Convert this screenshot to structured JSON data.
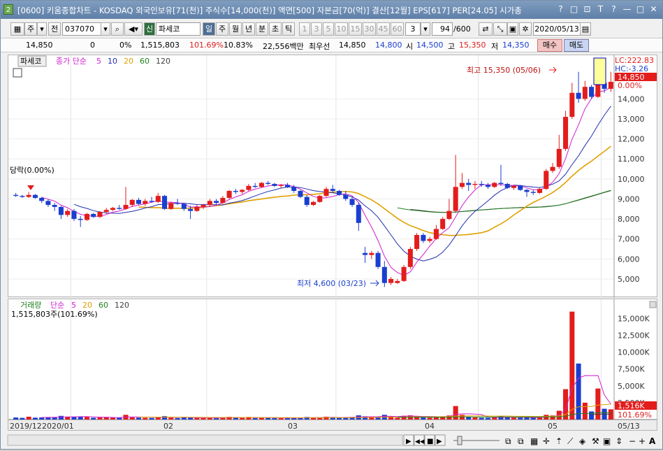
{
  "window": {
    "number": "2",
    "title": "[0600] 키움종합차트 - KOSDAQ 외국인보유[71(천)] 주식수[14,000(천)] 액면[500] 자본금[70(억)] 결산[12월] EPS[617] PER[24.05] 시가총",
    "buttons": [
      "?",
      "□",
      "⊡",
      "T",
      "?",
      "—",
      "□",
      "✕"
    ]
  },
  "toolbar": {
    "period_label": "주",
    "prev_label": "전",
    "code": "037070",
    "credit_label": "신",
    "stock_name": "파세코",
    "intervals": [
      "일",
      "주",
      "월",
      "년",
      "분",
      "초",
      "틱"
    ],
    "selected_interval": "일",
    "minute_options": [
      "1",
      "3",
      "5",
      "10",
      "15",
      "30",
      "45",
      "60"
    ],
    "count_select": "3",
    "page_count": "94",
    "page_total": "/600",
    "date": "2020/05/13"
  },
  "info": {
    "price": "14,850",
    "change": "0",
    "change_pct": "0%",
    "volume": "1,515,803",
    "volume_pct": "101.69%",
    "turnover": "10.83%",
    "amount": "22,556백만",
    "best_ask_label": "최우선",
    "best_ask": "14,850",
    "best_bid": "14,800",
    "open_label": "시",
    "open": "14,500",
    "high_label": "고",
    "high": "15,350",
    "low_label": "저",
    "low": "14,350",
    "buy_label": "매수",
    "sell_label": "매도"
  },
  "price_panel": {
    "stock_label": "파세코",
    "ma_label": "종가 단순",
    "ma_periods": [
      "5",
      "10",
      "20",
      "60",
      "120"
    ],
    "ma_colors": [
      "#d020d0",
      "#2030b0",
      "#e0a000",
      "#208020",
      "#404040"
    ],
    "lc_label": "LC:222.83",
    "hc_label": "HC:-3.26",
    "current_price_tag": "14,850",
    "current_pct_tag": "0.00%",
    "high_marker": "최고 15,350 (05/06)",
    "low_marker": "최저 4,600 (03/23)",
    "left_marker": "당락(0.00%)",
    "y_ticks": [
      "14,000",
      "13,000",
      "12,000",
      "11,000",
      "10,000",
      "9,000",
      "8,000",
      "7,000",
      "6,000",
      "5,000"
    ]
  },
  "volume_panel": {
    "label": "거래량",
    "ma_label": "단순",
    "ma_periods": [
      "5",
      "20",
      "60",
      "120"
    ],
    "value_text": "1,515,803주(101.69%)",
    "current_tag": "1,516K",
    "current_pct_tag": "101.69%",
    "y_ticks": [
      "15,000K",
      "12,500K",
      "10,000K",
      "7,500K",
      "5,000K",
      "2,500K"
    ]
  },
  "xaxis": {
    "labels": [
      "2019/12",
      "2020/01",
      "02",
      "03",
      "04",
      "05",
      "05/13"
    ]
  },
  "chart_data": {
    "type": "candlestick",
    "price_ylim": [
      4300,
      15900
    ],
    "volume_ylim": [
      0,
      17000
    ],
    "up_color": "#e31c1c",
    "down_color": "#1a3fcf",
    "candles": [
      [
        9200,
        9300,
        9100,
        9150,
        300
      ],
      [
        9150,
        9200,
        9050,
        9100,
        250
      ],
      [
        9100,
        9350,
        9050,
        9200,
        420
      ],
      [
        9200,
        9250,
        9000,
        9050,
        280
      ],
      [
        9050,
        9100,
        8800,
        8900,
        320
      ],
      [
        8900,
        9000,
        8600,
        8700,
        360
      ],
      [
        8700,
        8800,
        8400,
        8600,
        300
      ],
      [
        8600,
        8650,
        8000,
        8200,
        540
      ],
      [
        8200,
        8500,
        8100,
        8400,
        420
      ],
      [
        8400,
        8500,
        7900,
        8000,
        380
      ],
      [
        8000,
        8150,
        7600,
        7950,
        460
      ],
      [
        7950,
        8300,
        7900,
        8250,
        380
      ],
      [
        8250,
        8300,
        8050,
        8100,
        260
      ],
      [
        8100,
        8400,
        8050,
        8350,
        300
      ],
      [
        8350,
        8550,
        8250,
        8450,
        340
      ],
      [
        8450,
        8600,
        8400,
        8550,
        280
      ],
      [
        8550,
        8700,
        8450,
        8500,
        260
      ],
      [
        8500,
        9600,
        8450,
        8700,
        700
      ],
      [
        8700,
        9000,
        8600,
        8950,
        320
      ],
      [
        8950,
        9050,
        8700,
        8750,
        280
      ],
      [
        8750,
        9000,
        8650,
        8900,
        260
      ],
      [
        8900,
        9100,
        8800,
        8850,
        240
      ],
      [
        8850,
        9300,
        8800,
        9150,
        380
      ],
      [
        9150,
        9200,
        8450,
        8500,
        500
      ],
      [
        8500,
        8850,
        8450,
        8800,
        280
      ],
      [
        8800,
        9000,
        8700,
        8750,
        220
      ],
      [
        8750,
        8800,
        8400,
        8500,
        300
      ],
      [
        8500,
        8650,
        8000,
        8400,
        260
      ],
      [
        8400,
        8700,
        8350,
        8600,
        240
      ],
      [
        8600,
        8750,
        8500,
        8700,
        220
      ],
      [
        8700,
        9000,
        8600,
        8900,
        300
      ],
      [
        8900,
        9000,
        8700,
        8800,
        200
      ],
      [
        8800,
        9150,
        8750,
        9050,
        320
      ],
      [
        9050,
        9450,
        9000,
        9400,
        400
      ],
      [
        9400,
        9500,
        9250,
        9350,
        260
      ],
      [
        9350,
        9500,
        9250,
        9450,
        240
      ],
      [
        9450,
        9750,
        9400,
        9650,
        380
      ],
      [
        9650,
        9800,
        9550,
        9600,
        240
      ],
      [
        9600,
        9850,
        9550,
        9800,
        300
      ],
      [
        9800,
        9900,
        9700,
        9750,
        260
      ],
      [
        9750,
        9800,
        9600,
        9650,
        220
      ],
      [
        9650,
        9750,
        9550,
        9700,
        200
      ],
      [
        9700,
        9800,
        9550,
        9600,
        200
      ],
      [
        9600,
        9700,
        9300,
        9400,
        260
      ],
      [
        9400,
        9450,
        9050,
        9100,
        300
      ],
      [
        9100,
        9200,
        8600,
        8700,
        380
      ],
      [
        8700,
        8900,
        8650,
        8850,
        240
      ],
      [
        8850,
        9200,
        8800,
        9150,
        280
      ],
      [
        9150,
        9600,
        9100,
        9500,
        420
      ],
      [
        9500,
        9700,
        9300,
        9400,
        300
      ],
      [
        9400,
        9450,
        9150,
        9200,
        260
      ],
      [
        9200,
        9400,
        8900,
        9000,
        300
      ],
      [
        9000,
        9100,
        8600,
        8700,
        360
      ],
      [
        8700,
        8800,
        7400,
        7800,
        620
      ],
      [
        6300,
        6600,
        5800,
        6200,
        480
      ],
      [
        6200,
        6400,
        6000,
        6300,
        300
      ],
      [
        6300,
        6400,
        5500,
        5600,
        380
      ],
      [
        5600,
        5900,
        4600,
        4800,
        700
      ],
      [
        4800,
        5100,
        4700,
        5000,
        520
      ],
      [
        4800,
        5000,
        4750,
        4900,
        260
      ],
      [
        4900,
        5700,
        4850,
        5600,
        560
      ],
      [
        5600,
        6600,
        5500,
        6500,
        620
      ],
      [
        6500,
        7300,
        6400,
        7200,
        520
      ],
      [
        7200,
        7300,
        6800,
        6900,
        300
      ],
      [
        6900,
        7100,
        6800,
        7000,
        260
      ],
      [
        7000,
        7700,
        6950,
        7500,
        420
      ],
      [
        7500,
        8100,
        7450,
        8000,
        480
      ],
      [
        8000,
        9000,
        7950,
        8400,
        600
      ],
      [
        8400,
        11200,
        8300,
        9600,
        2000
      ],
      [
        9600,
        10300,
        9500,
        9800,
        700
      ],
      [
        9800,
        10000,
        9400,
        9700,
        420
      ],
      [
        9700,
        9900,
        9500,
        9750,
        300
      ],
      [
        9750,
        9900,
        9600,
        9700,
        260
      ],
      [
        9700,
        9800,
        9500,
        9600,
        260
      ],
      [
        9600,
        9850,
        9550,
        9800,
        300
      ],
      [
        9800,
        10700,
        9650,
        9750,
        500
      ],
      [
        9750,
        9800,
        9500,
        9550,
        300
      ],
      [
        9550,
        9700,
        9450,
        9650,
        260
      ],
      [
        9650,
        9700,
        9400,
        9450,
        280
      ],
      [
        9450,
        9500,
        9100,
        9350,
        300
      ],
      [
        9350,
        9450,
        9200,
        9300,
        260
      ],
      [
        9300,
        9550,
        9250,
        9500,
        320
      ],
      [
        9500,
        10500,
        9450,
        10400,
        700
      ],
      [
        10400,
        10800,
        10300,
        10600,
        600
      ],
      [
        10600,
        12200,
        10500,
        11500,
        1300
      ],
      [
        11500,
        13400,
        11400,
        13100,
        4500
      ],
      [
        13100,
        14800,
        13000,
        14300,
        16000
      ],
      [
        14300,
        15350,
        13800,
        14000,
        8300
      ],
      [
        14000,
        14900,
        13900,
        14600,
        2500
      ],
      [
        14600,
        14700,
        14000,
        14100,
        1200
      ],
      [
        14100,
        15100,
        14050,
        14800,
        4600
      ],
      [
        14800,
        15050,
        14300,
        14500,
        1600
      ],
      [
        14500,
        15350,
        14350,
        14850,
        1516
      ]
    ]
  }
}
